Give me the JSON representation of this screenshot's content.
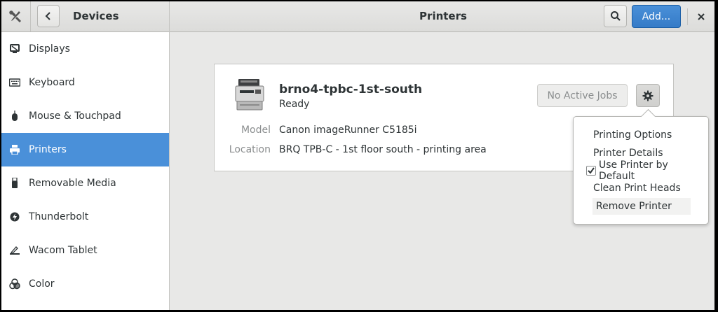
{
  "header": {
    "left_title": "Devices",
    "center_title": "Printers",
    "add_label": "Add..."
  },
  "sidebar": {
    "items": [
      {
        "label": "Displays",
        "icon": "display-icon"
      },
      {
        "label": "Keyboard",
        "icon": "keyboard-icon"
      },
      {
        "label": "Mouse & Touchpad",
        "icon": "mouse-icon"
      },
      {
        "label": "Printers",
        "icon": "printer-icon",
        "selected": true
      },
      {
        "label": "Removable Media",
        "icon": "usb-icon"
      },
      {
        "label": "Thunderbolt",
        "icon": "thunderbolt-icon"
      },
      {
        "label": "Wacom Tablet",
        "icon": "tablet-icon"
      },
      {
        "label": "Color",
        "icon": "color-icon"
      }
    ]
  },
  "printer": {
    "name": "brno4-tpbc-1st-south",
    "status": "Ready",
    "model_label": "Model",
    "model_value": "Canon imageRunner C5185i",
    "location_label": "Location",
    "location_value": "BRQ TPB-C - 1st floor south - printing area",
    "jobs_label": "No Active Jobs"
  },
  "menu": {
    "items": [
      {
        "label": "Printing Options"
      },
      {
        "label": "Printer Details"
      },
      {
        "label": "Use Printer by Default",
        "checked": true
      },
      {
        "label": "Clean Print Heads"
      },
      {
        "label": "Remove Printer",
        "hover": true
      }
    ]
  },
  "colors": {
    "accent": "#4a90d9",
    "window_bg": "#e8e8e7",
    "card_bg": "#ffffff"
  }
}
